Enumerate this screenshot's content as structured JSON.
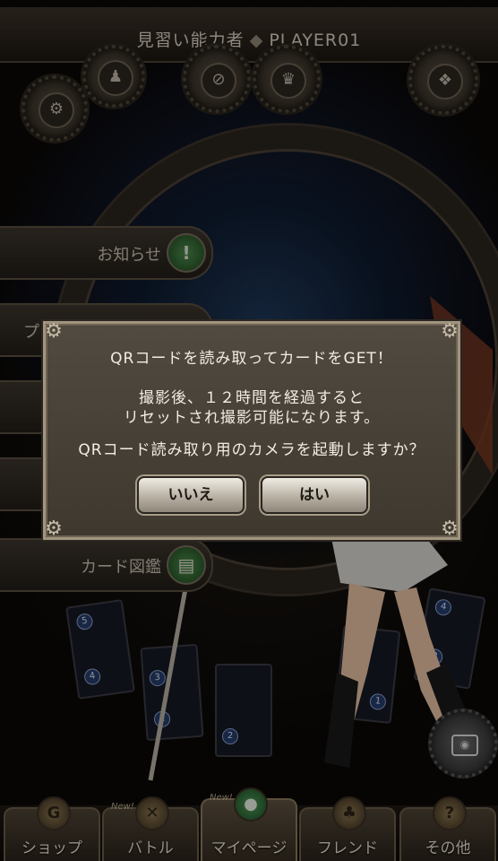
{
  "header": {
    "rank": "見習い能力者",
    "player": "PLAYER01"
  },
  "side_menu": [
    {
      "label": "お知らせ",
      "icon": "exclamation-icon"
    },
    {
      "label": "プ",
      "icon": "gear-icon"
    },
    {
      "label": "",
      "icon": ""
    },
    {
      "label": "",
      "icon": ""
    },
    {
      "label": "カード図鑑",
      "icon": "book-icon"
    }
  ],
  "dialog": {
    "title": "QRコードを読み取ってカードをGET！",
    "line1": "撮影後、１２時間を経過すると",
    "line2": "リセットされ撮影可能になります。",
    "question": "QRコード読み取り用のカメラを起動しますか？",
    "no_label": "いいえ",
    "yes_label": "はい"
  },
  "nav": {
    "tabs": [
      {
        "label": "ショップ",
        "icon": "G"
      },
      {
        "label": "バトル",
        "icon": "✕"
      },
      {
        "label": "マイページ",
        "icon": "●"
      },
      {
        "label": "フレンド",
        "icon": "♣"
      },
      {
        "label": "その他",
        "icon": "?"
      }
    ],
    "new_label": "New!"
  },
  "cards": [
    "5",
    "4",
    "3",
    "4",
    "1",
    "2",
    "1",
    "4",
    "3"
  ],
  "colors": {
    "dialog_bg": "#4a4339",
    "dialog_border": "#a19580",
    "active_tab": "#4f9a5a"
  }
}
